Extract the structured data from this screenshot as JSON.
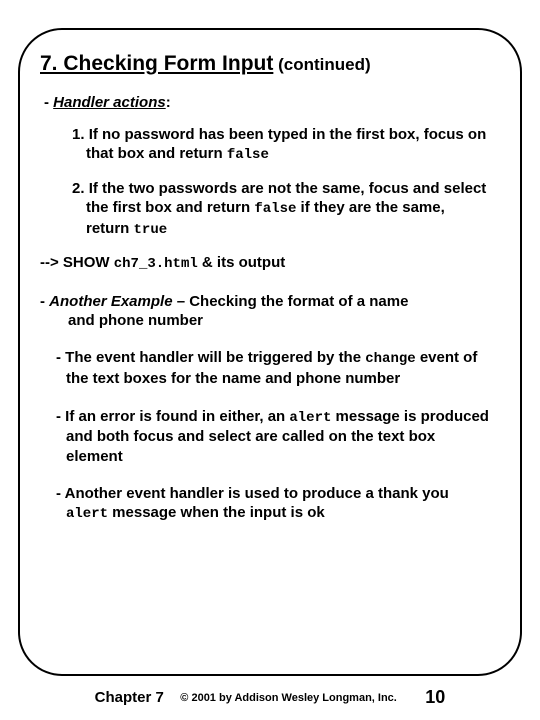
{
  "title": {
    "main": "7. Checking Form Input",
    "suffix": " (continued)"
  },
  "handler": {
    "lead_dash": "- ",
    "label": "Handler actions",
    "colon": ":"
  },
  "items": [
    {
      "num": "1. ",
      "pre": "If no password has been typed in the first box, focus on that box and return ",
      "code": "false",
      "post": ""
    },
    {
      "num": "2. ",
      "pre": "If the two passwords are not the same, focus and select the first box and return ",
      "code": "false",
      "post_line": " if they are the same, return ",
      "code2": "true"
    }
  ],
  "show": {
    "pre": "--> SHOW ",
    "code": "ch7_3.html",
    "post": " & its output"
  },
  "example": {
    "dash": "- ",
    "label_italic": "Another Example",
    "tail1": " – Checking the format of a name",
    "tail2": "and phone number"
  },
  "subs": [
    {
      "dash": "- ",
      "p1": "The event handler will be triggered by the ",
      "c1": "change",
      "p2": " event of the text boxes for the name and phone number"
    },
    {
      "dash": "- ",
      "p1": "If an error is found in either, an ",
      "c1": "alert",
      "p2": " message is produced and both focus and select are called on the text box element"
    },
    {
      "dash": "- ",
      "p1": "Another event handler is used to produce a thank you ",
      "c1": "alert",
      "p2": " message when the input is ok"
    }
  ],
  "footer": {
    "chapter": "Chapter 7",
    "copy": "© 2001 by Addison Wesley Longman, Inc.",
    "page": "10"
  }
}
